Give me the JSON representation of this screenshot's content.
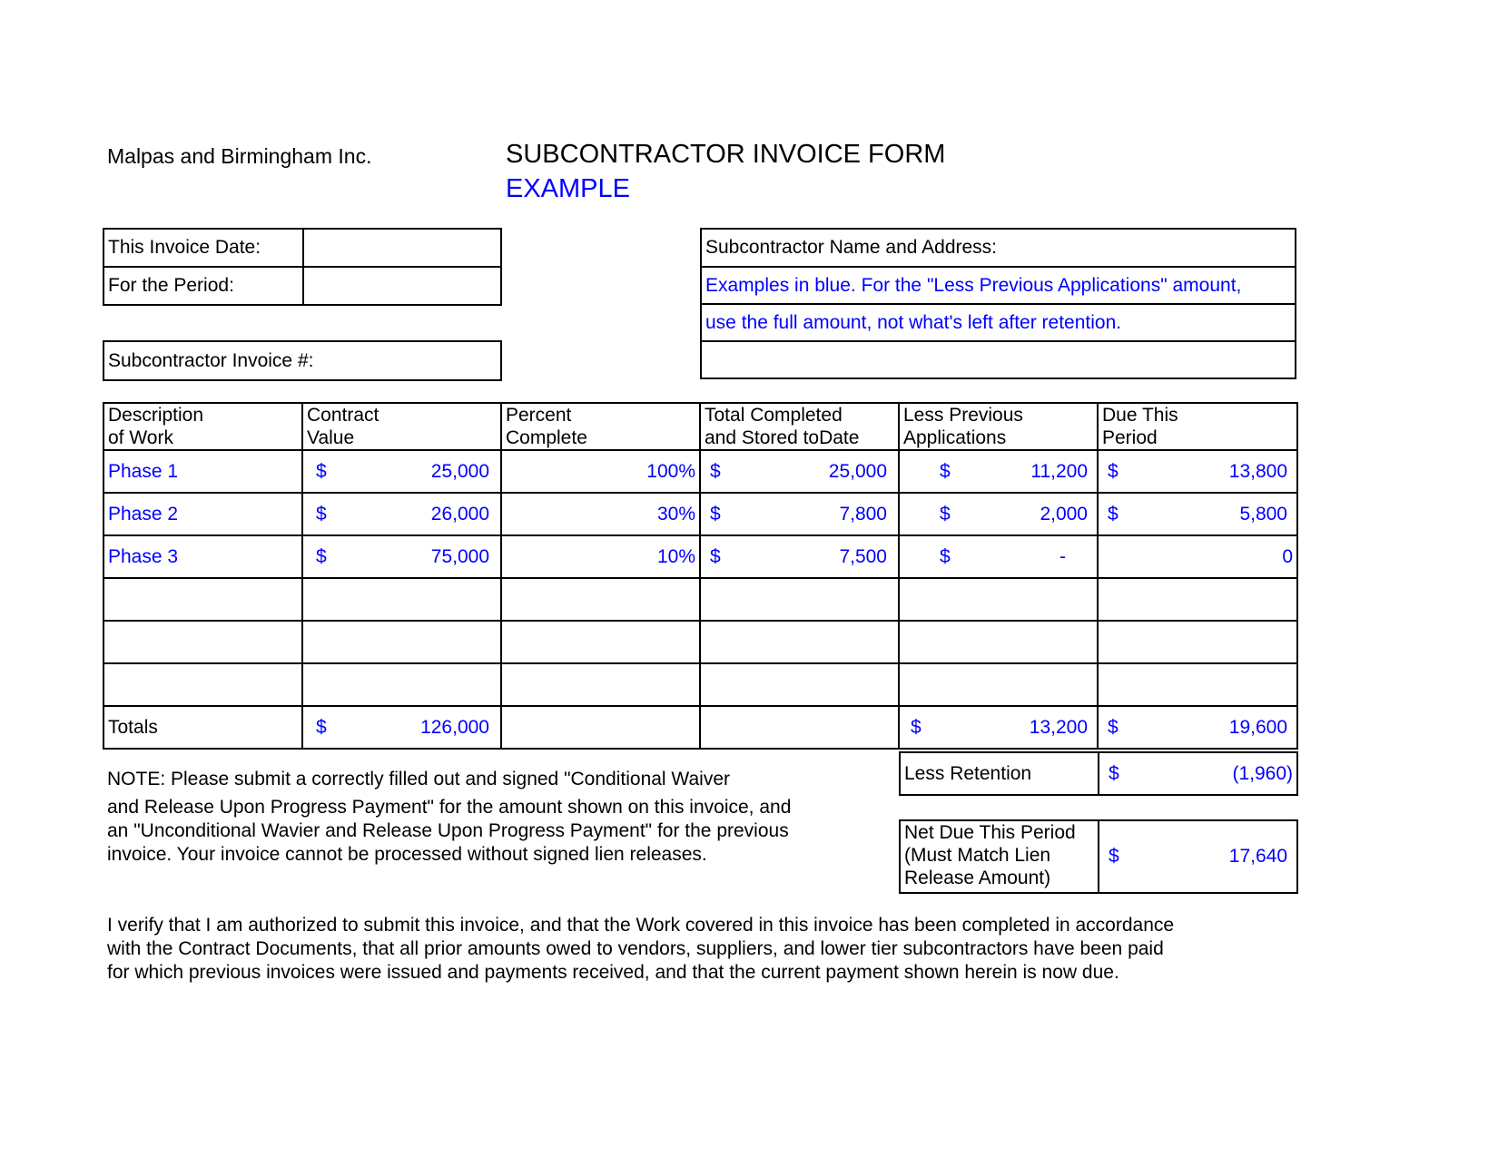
{
  "header": {
    "company": "Malpas and Birmingham Inc.",
    "title": "SUBCONTRACTOR INVOICE FORM",
    "subtitle": "EXAMPLE"
  },
  "invoice_info": {
    "date_label": "This Invoice Date:",
    "date_value": "",
    "period_label": "For the Period:",
    "period_value": "",
    "invoice_no_label": "Subcontractor Invoice #:"
  },
  "subcontractor": {
    "label": "Subcontractor Name and Address:",
    "line1": "Examples in blue.  For the \"Less Previous Applications\" amount,",
    "line2": "use the full amount, not what's left after retention.",
    "line3": ""
  },
  "table": {
    "headers": [
      {
        "l1": "Description",
        "l2": "of Work"
      },
      {
        "l1": "Contract",
        "l2": "Value"
      },
      {
        "l1": "Percent",
        "l2": "Complete"
      },
      {
        "l1": "Total Completed",
        "l2": "and Stored toDate"
      },
      {
        "l1": "Less Previous",
        "l2": "Applications"
      },
      {
        "l1": "Due This",
        "l2": "Period"
      }
    ],
    "rows": [
      {
        "desc": "Phase 1",
        "contract": "25,000",
        "percent": "100%",
        "total": "25,000",
        "previous": "11,200",
        "due": "13,800",
        "due_cur": "$"
      },
      {
        "desc": "Phase 2",
        "contract": "26,000",
        "percent": "30%",
        "total": "7,800",
        "previous": "2,000",
        "due": "5,800",
        "due_cur": "$"
      },
      {
        "desc": "Phase 3",
        "contract": "75,000",
        "percent": "10%",
        "total": "7,500",
        "previous": "-",
        "due": "0",
        "due_cur": ""
      }
    ],
    "currency": "$",
    "totals": {
      "label": "Totals",
      "contract": "126,000",
      "previous": "13,200",
      "due": "19,600"
    },
    "retention": {
      "label": "Less Retention",
      "value": "(1,960)"
    },
    "net_due": {
      "l1": "Net Due This Period",
      "l2": "(Must Match Lien",
      "l3": "Release Amount)",
      "value": "17,640"
    }
  },
  "note": {
    "lines": [
      "NOTE:  Please submit a correctly filled out and signed \"Conditional Waiver",
      "and Release Upon Progress Payment\" for the amount shown on this invoice, and",
      "an \"Unconditional Wavier and Release Upon Progress Payment\" for the previous",
      "invoice. Your invoice cannot be processed without signed lien releases."
    ]
  },
  "verification": {
    "lines": [
      "I verify that I am authorized to submit this invoice, and that the Work covered in this invoice has been completed in accordance",
      "with the Contract Documents, that all prior amounts owed to vendors, suppliers, and lower tier subcontractors have been paid",
      "for which previous invoices were issued and payments received, and that the current payment shown herein is now due."
    ]
  },
  "colors": {
    "example_blue": "#0000ff",
    "text": "#000000"
  }
}
